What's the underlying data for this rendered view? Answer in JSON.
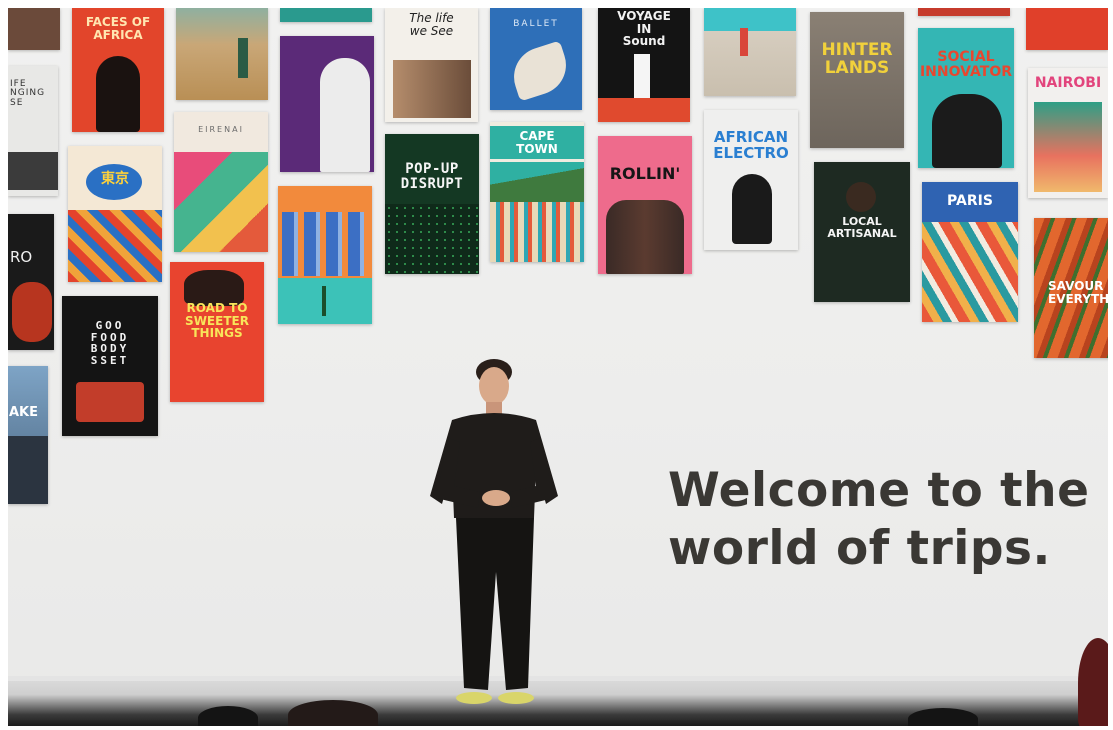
{
  "posters": {
    "p_africa": "FACES OF\nAFRICA",
    "p_life_we_see": "The life\nwe See",
    "p_ballet": "BALLET",
    "p_voyage": "VOYAGE\nIN\nSound",
    "p_hinterlands": "HINTER\nLANDS",
    "p_social": "SOCIAL\nINNOVATOR",
    "p_nairobi": "NAIROBI",
    "p_banging": "IFE\nNGING\nSE",
    "p_tokyo": "東京",
    "p_eirenai": "EIRENAI",
    "p_popup": "POP-UP\nDISRUPT",
    "p_capetown": "CAPE\nTOWN",
    "p_rollin": "ROLLIN'",
    "p_african_electro": "AFRICAN\nELECTRO",
    "p_local_artisanal": "LOCAL\nARTISANAL",
    "p_paris": "PARIS",
    "p_savour": "SAVOUR\nEVERYTHING",
    "p_ro": "RO",
    "p_good_food": "GOO\nFOOD\nBODY\nSSET",
    "p_road_sweeter": "ROAD TO\nSWEETER\nTHINGS",
    "p_ake": "AKE"
  },
  "slide": {
    "headline_line1": "Welcome to the",
    "headline_line2": "world of trips."
  },
  "colors": {
    "headline": "#3a3834",
    "backdrop": "#efefee",
    "shirt": "#1f1c1a"
  }
}
